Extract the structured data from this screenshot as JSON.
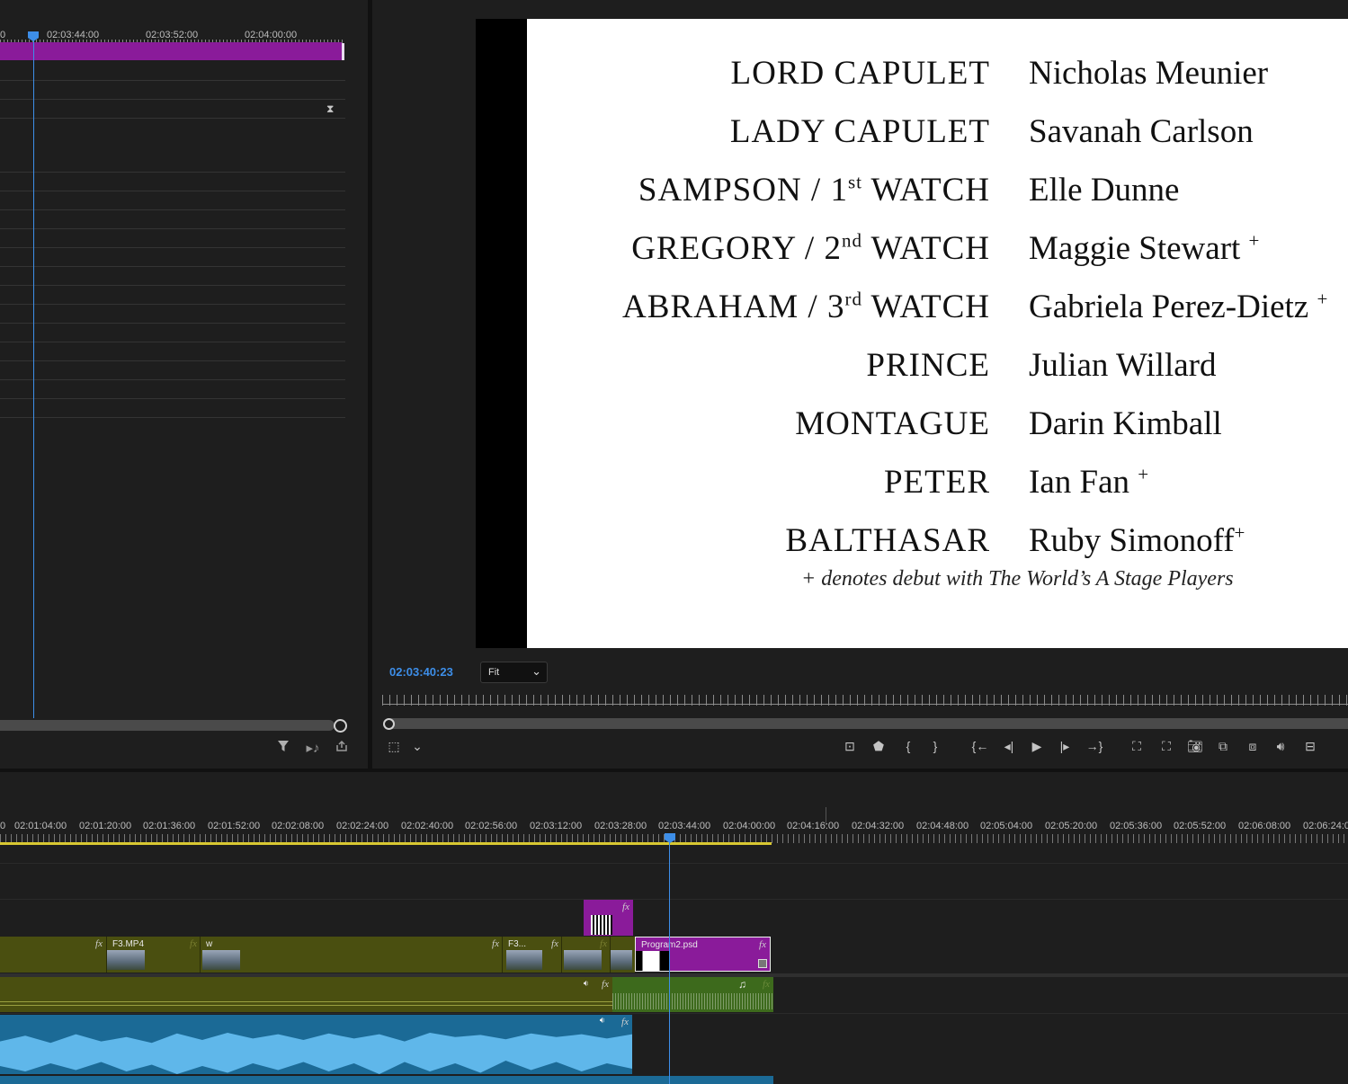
{
  "source_monitor": {
    "timecodes": [
      "02:03:44:00",
      "02:03:52:00",
      "02:04:00:00"
    ],
    "tc_left_edge": "0",
    "buttons": [
      "filter-icon",
      "insert-audio-icon",
      "export-icon"
    ]
  },
  "program_monitor": {
    "timecode": "02:03:40:23",
    "zoom": "Fit",
    "cast": [
      {
        "role": "LORD CAPULET",
        "actor": "Nicholas Meunier",
        "debut": false
      },
      {
        "role": "LADY CAPULET",
        "actor": "Savanah Carlson",
        "debut": false
      },
      {
        "role_pre": "SAMPSON / 1",
        "role_sup": "st",
        "role_post": " WATCH",
        "actor": "Elle Dunne",
        "debut": false
      },
      {
        "role_pre": "GREGORY / 2",
        "role_sup": "nd",
        "role_post": " WATCH",
        "actor": "Maggie Stewart",
        "debut": true
      },
      {
        "role_pre": "ABRAHAM / 3",
        "role_sup": "rd",
        "role_post": " WATCH",
        "actor": "Gabriela Perez-Dietz",
        "debut": true
      },
      {
        "role": "PRINCE",
        "actor": "Julian Willard",
        "debut": false
      },
      {
        "role": "MONTAGUE",
        "actor": "Darin Kimball",
        "debut": false
      },
      {
        "role": "PETER",
        "actor": "Ian Fan",
        "debut": true
      },
      {
        "role": "BALTHASAR",
        "actor": "Ruby Simonoff",
        "debut": true
      }
    ],
    "debut_mark": "+",
    "note": "+ denotes debut with The World’s A Stage Players"
  },
  "timeline": {
    "timecodes": [
      "0",
      "02:01:04:00",
      "02:01:20:00",
      "02:01:36:00",
      "02:01:52:00",
      "02:02:08:00",
      "02:02:24:00",
      "02:02:40:00",
      "02:02:56:00",
      "02:03:12:00",
      "02:03:28:00",
      "02:03:44:00",
      "02:04:00:00",
      "02:04:16:00",
      "02:04:32:00",
      "02:04:48:00",
      "02:05:04:00",
      "02:05:20:00",
      "02:05:36:00",
      "02:05:52:00",
      "02:06:08:00",
      "02:06:24:0"
    ],
    "clips": {
      "f3_mp4": "F3.MP4",
      "w": "w",
      "f3_short": "F3...",
      "program2": "Program2.psd"
    },
    "fx_label": "fx",
    "colors": {
      "video_clip": "#4a4f10",
      "graphic_clip": "#8a1b9a",
      "audio_clip": "#3a9fd6",
      "playhead": "#3d8ee8",
      "work_area": "#d8c832"
    }
  }
}
